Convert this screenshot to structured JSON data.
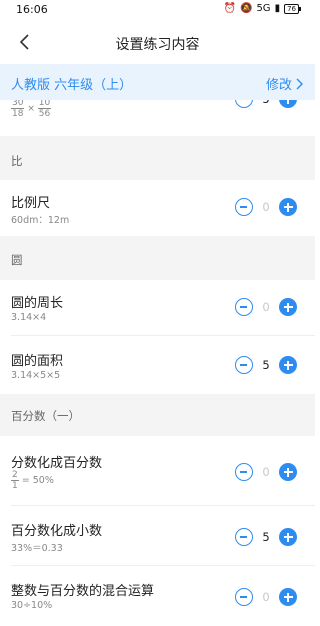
{
  "status": {
    "time": "16:06",
    "signal": "5G",
    "battery": "76"
  },
  "nav": {
    "title": "设置练习内容"
  },
  "edition": {
    "name": "人教版 六年级（上）",
    "edit_label": "修改"
  },
  "partial_item": {
    "frac1_num": "30",
    "frac1_den": "18",
    "times": "×",
    "frac2_num": "10",
    "frac2_den": "56",
    "count": "5"
  },
  "sections": {
    "ratio": "比",
    "circle": "圆",
    "percent": "百分数（一）"
  },
  "items": {
    "scale": {
      "title": "比例尺",
      "example": "60dm：12m",
      "count": "0"
    },
    "circumference": {
      "title": "圆的周长",
      "example": "3.14×4",
      "count": "0"
    },
    "area": {
      "title": "圆的面积",
      "example": "3.14×5×5",
      "count": "5"
    },
    "frac_to_pct": {
      "title": "分数化成百分数",
      "ex_num": "2",
      "ex_den": "1",
      "ex_rest": "= 50%",
      "count": "0"
    },
    "pct_to_dec": {
      "title": "百分数化成小数",
      "example": "33%＝0.33",
      "count": "5"
    },
    "mixed": {
      "title": "整数与百分数的混合运算",
      "example": "30÷10%",
      "count": "0"
    }
  },
  "colors": {
    "accent": "#2e8cf0",
    "section_bg": "#f4f4f4",
    "edition_bg": "#e9f3fd"
  }
}
